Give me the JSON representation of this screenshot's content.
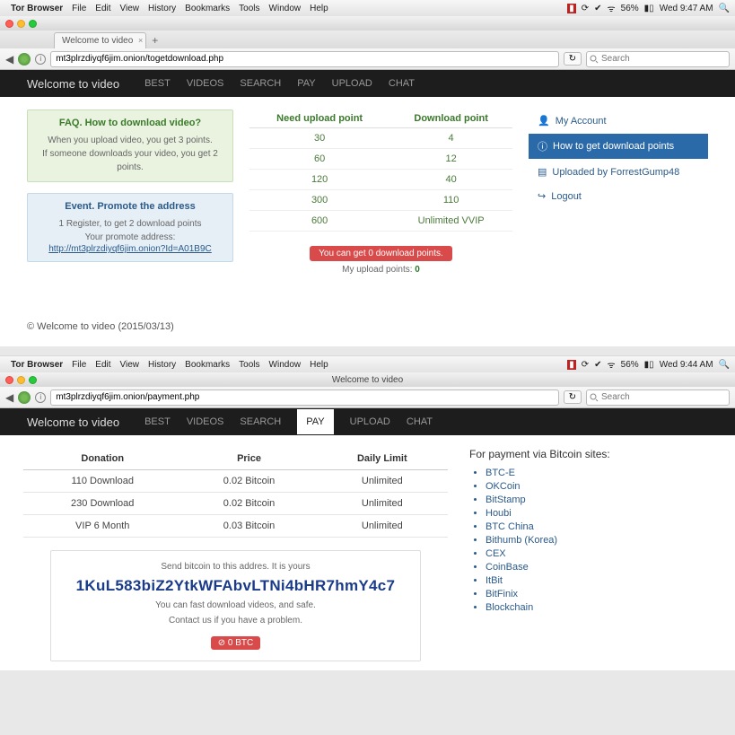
{
  "menubar": {
    "app": "Tor Browser",
    "items": [
      "File",
      "Edit",
      "View",
      "History",
      "Bookmarks",
      "Tools",
      "Window",
      "Help"
    ],
    "battery": "56%",
    "time1": "Wed 9:47 AM",
    "time2": "Wed 9:44 AM"
  },
  "tab1": {
    "title": "Welcome to video"
  },
  "url1": "mt3plrzdiyqf6jim.onion/togetdownload.php",
  "url2": "mt3plrzdiyqf6jim.onion/payment.php",
  "search_ph": "Search",
  "titlebar2": "Welcome to video",
  "nav": {
    "brand": "Welcome to video",
    "items": [
      "BEST",
      "VIDEOS",
      "SEARCH",
      "PAY",
      "UPLOAD",
      "CHAT"
    ]
  },
  "faq": {
    "heading": "FAQ. How to download video?",
    "line1": "When you upload video, you get 3 points.",
    "line2": "If someone downloads your video, you get 2 points."
  },
  "event": {
    "heading": "Event. Promote the address",
    "line1": "1 Register, to get 2 download points",
    "line2": "Your promote address:",
    "link": "http://mt3plrzdiyqf6jim.onion?Id=A01B9C"
  },
  "points": {
    "h1": "Need upload point",
    "h2": "Download point",
    "rows": [
      {
        "u": "30",
        "d": "4"
      },
      {
        "u": "60",
        "d": "12"
      },
      {
        "u": "120",
        "d": "40"
      },
      {
        "u": "300",
        "d": "110"
      },
      {
        "u": "600",
        "d": "Unlimited VVIP"
      }
    ],
    "badge": "You can get 0 download points.",
    "sub_pre": "My upload points: ",
    "sub_val": "0"
  },
  "sidenav": {
    "account": "My Account",
    "howto": "How to get download points",
    "uploaded": "Uploaded by ForrestGump48",
    "logout": "Logout"
  },
  "footer": "© Welcome to video (2015/03/13)",
  "donate": {
    "h1": "Donation",
    "h2": "Price",
    "h3": "Daily Limit",
    "rows": [
      {
        "d": "110 Download",
        "p": "0.02 Bitcoin",
        "l": "Unlimited"
      },
      {
        "d": "230 Download",
        "p": "0.02 Bitcoin",
        "l": "Unlimited"
      },
      {
        "d": "VIP 6 Month",
        "p": "0.03 Bitcoin",
        "l": "Unlimited"
      }
    ]
  },
  "paybox": {
    "note1": "Send bitcoin to this addres. It is yours",
    "addr": "1KuL583biZ2YtkWFAbvLTNi4bHR7hmY4c7",
    "note2": "You can fast download videos, and safe.",
    "note3": "Contact us if you have a problem.",
    "btc": "⊘ 0 BTC"
  },
  "paysites": {
    "heading": "For payment via Bitcoin sites:",
    "items": [
      "BTC-E",
      "OKCoin",
      "BitStamp",
      "Houbi",
      "BTC China",
      "Bithumb (Korea)",
      "CEX",
      "CoinBase",
      "ItBit",
      "BitFinix",
      "Blockchain"
    ]
  }
}
